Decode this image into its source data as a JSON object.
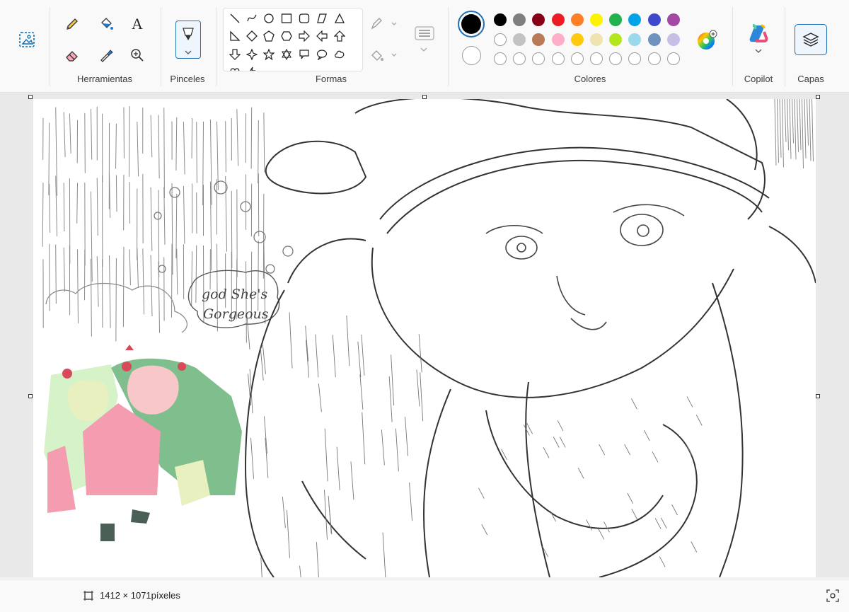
{
  "ribbon": {
    "groups": {
      "tools": "Herramientas",
      "brushes": "Pinceles",
      "shapes": "Formas",
      "colors": "Colores",
      "copilot": "Copilot",
      "layers": "Capas"
    },
    "text_tool_glyph": "A"
  },
  "colors": {
    "primary": "#000000",
    "secondary": "#ffffff",
    "palette_row1": [
      "#000000",
      "#7f7f7f",
      "#880015",
      "#ed1c24",
      "#ff7f27",
      "#fff200",
      "#22b14c",
      "#00a2e8",
      "#3f48cc",
      "#a349a4"
    ],
    "palette_row2": [
      "#ffffff",
      "#c3c3c3",
      "#b97a57",
      "#ffaec9",
      "#ffc90e",
      "#efe4b0",
      "#b5e61d",
      "#99d9ea",
      "#7092be",
      "#c8bfe7"
    ]
  },
  "canvas": {
    "speech_line1": "god She's",
    "speech_line2": "Gorgeous"
  },
  "status": {
    "dimensions": "1412 × 1071píxeles"
  }
}
